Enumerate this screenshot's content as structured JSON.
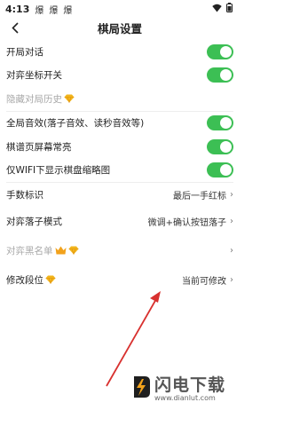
{
  "status_bar": {
    "time": "4:13",
    "notifications": [
      "爆",
      "爆",
      "爆"
    ]
  },
  "header": {
    "title": "棋局设置"
  },
  "settings": [
    {
      "label": "开局对话",
      "control": "toggle",
      "on": true
    },
    {
      "label": "对弈坐标开关",
      "control": "toggle",
      "on": true
    },
    {
      "label": "隐藏对局历史",
      "control": "none",
      "disabled": true,
      "badge": "diamond"
    },
    {
      "label": "全局音效(落子音效、读秒音效等)",
      "control": "toggle",
      "on": true
    },
    {
      "label": "棋谱页屏幕常亮",
      "control": "toggle",
      "on": true
    },
    {
      "label": "仅WIFI下显示棋盘缩略图",
      "control": "toggle",
      "on": true
    },
    {
      "label": "手数标识",
      "control": "value",
      "value": "最后一手红标"
    },
    {
      "label": "对弈落子模式",
      "control": "value",
      "value": "微调+确认按钮落子"
    },
    {
      "label": "对弈黑名单",
      "control": "chevron",
      "disabled": true,
      "badge": "crown-diamond"
    },
    {
      "label": "修改段位",
      "control": "value",
      "value": "当前可修改",
      "badge": "diamond"
    }
  ],
  "watermark": {
    "title": "闪电下载",
    "url": "www.dianlut.com"
  },
  "colors": {
    "toggle_on": "#3cbf54",
    "arrow": "#d8312f",
    "diamond": "#f2b51c"
  }
}
